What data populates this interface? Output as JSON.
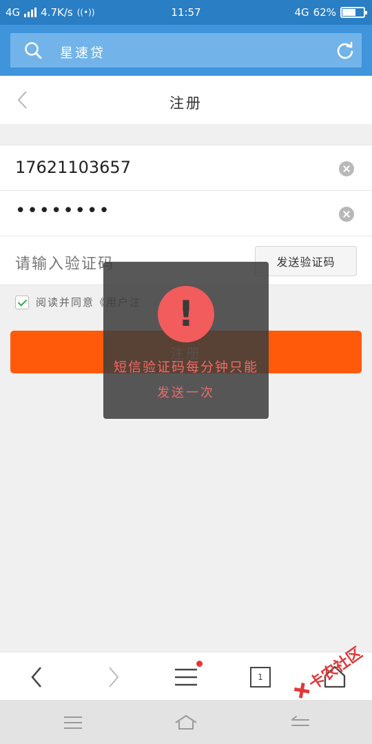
{
  "status_bar": {
    "network": "4G",
    "speed": "4.7K/s",
    "time": "11:57",
    "network_right": "4G",
    "battery_percent": "62%",
    "battery_level": 0.62
  },
  "browser": {
    "url_text": "星速贷"
  },
  "page": {
    "title": "注册"
  },
  "form": {
    "phone_value": "17621103657",
    "password_value": "••••••••",
    "code_placeholder": "请输入验证码",
    "send_code_label": "发送验证码",
    "agreement_text": "阅读并同意《用户注",
    "agreement_checked": true,
    "register_label": "注册"
  },
  "toast": {
    "line1": "短信验证码每分钟只能",
    "line2": "发送一次",
    "icon_glyph": "!"
  },
  "browser_nav": {
    "tab_count": "1"
  },
  "watermark": {
    "text": "卡农社区"
  },
  "colors": {
    "status_bar": "#2a7ec4",
    "browser_bar": "#3f94dc",
    "register_button": "#ff5a0a",
    "toast_icon": "#f25c5c",
    "toast_text": "#f06a6a"
  }
}
